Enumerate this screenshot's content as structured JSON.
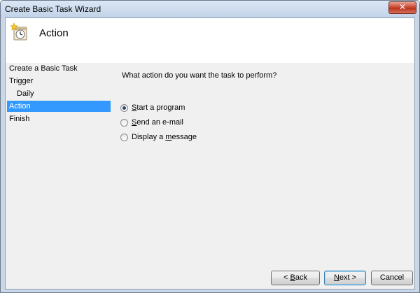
{
  "window": {
    "title": "Create Basic Task Wizard",
    "close_glyph": "✕"
  },
  "header": {
    "title": "Action",
    "icon": "task-scheduler-icon"
  },
  "sidebar": {
    "items": [
      {
        "label": "Create a Basic Task"
      },
      {
        "label": "Trigger"
      },
      {
        "label": "Daily"
      },
      {
        "label": "Action"
      },
      {
        "label": "Finish"
      }
    ],
    "selected": "Action"
  },
  "main": {
    "prompt": "What action do you want the task to perform?",
    "options": [
      {
        "pre": "",
        "key": "S",
        "post": "tart a program",
        "checked": true
      },
      {
        "pre": "",
        "key": "S",
        "post": "end an e-mail",
        "checked": false
      },
      {
        "pre": "Display a ",
        "key": "m",
        "post": "essage",
        "checked": false
      }
    ]
  },
  "buttons": {
    "back": {
      "pre": "< ",
      "key": "B",
      "post": "ack"
    },
    "next": {
      "pre": "",
      "key": "N",
      "post": "ext >"
    },
    "cancel": {
      "label": "Cancel"
    }
  },
  "colors": {
    "selection": "#3399ff",
    "titlebar": "#c9d7e8"
  }
}
